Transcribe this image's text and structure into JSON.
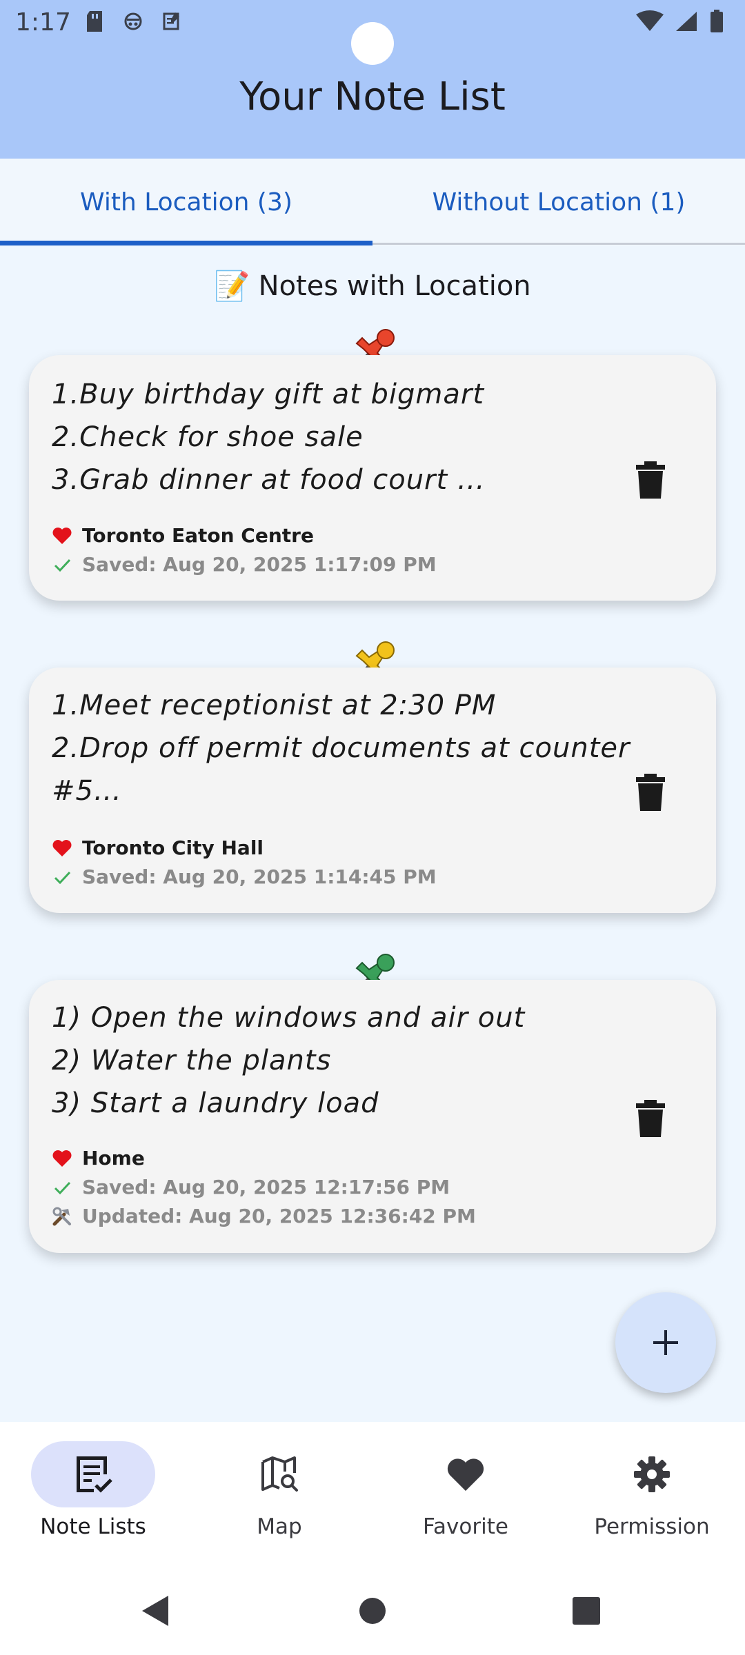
{
  "status_bar": {
    "time": "1:17"
  },
  "header": {
    "title": "Your Note List"
  },
  "tabs": [
    {
      "label": "With Location (3)",
      "active": true
    },
    {
      "label": "Without Location (1)",
      "active": false
    }
  ],
  "section": {
    "emoji": "📝",
    "title": "Notes with Location"
  },
  "notes": [
    {
      "pin_color": "#e8452c",
      "lines": [
        "1.Buy birthday gift at bigmart",
        "2.Check for shoe sale",
        "3.Grab dinner at food court …"
      ],
      "location": "Toronto Eaton Centre",
      "saved": "Saved: Aug 20, 2025 1:17:09 PM"
    },
    {
      "pin_color": "#f2c21b",
      "lines": [
        "1.Meet receptionist at 2:30 PM",
        "2.Drop off permit documents at counter",
        "#5…"
      ],
      "location": "Toronto City Hall",
      "saved": "Saved: Aug 20, 2025 1:14:45 PM"
    },
    {
      "pin_color": "#3aa05a",
      "lines": [
        "1) Open the windows and air out",
        "2) Water the plants",
        "3) Start a laundry load"
      ],
      "location": "Home",
      "saved": "Saved: Aug 20, 2025 12:17:56 PM",
      "updated": "Updated: Aug 20, 2025 12:36:42 PM"
    }
  ],
  "fab": {
    "icon": "plus-icon"
  },
  "bottom_nav": [
    {
      "label": "Note Lists",
      "icon": "note-list-icon",
      "active": true
    },
    {
      "label": "Map",
      "icon": "map-search-icon",
      "active": false
    },
    {
      "label": "Favorite",
      "icon": "heart-icon",
      "active": false
    },
    {
      "label": "Permission",
      "icon": "gear-icon",
      "active": false
    }
  ],
  "colors": {
    "header_bg": "#a9c7f9",
    "accent": "#1d5fc8",
    "heart": "#e3121b",
    "check": "#3fae5a"
  }
}
